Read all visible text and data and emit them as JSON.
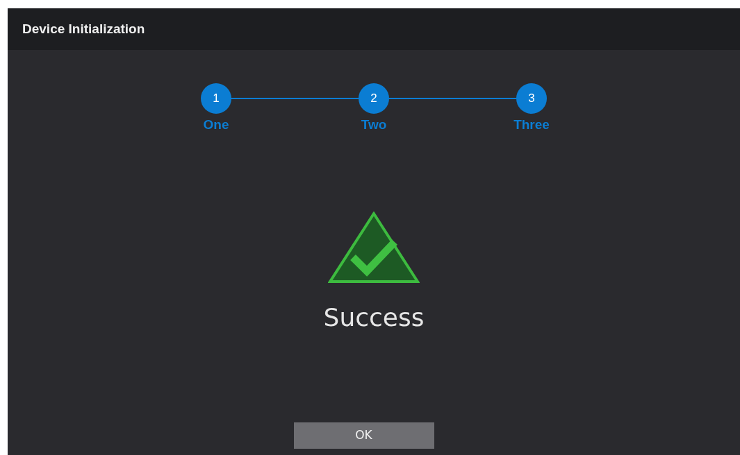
{
  "window": {
    "title": "Device Initialization"
  },
  "steps": [
    {
      "number": "1",
      "label": "One",
      "done": true
    },
    {
      "number": "2",
      "label": "Two",
      "done": true
    },
    {
      "number": "3",
      "label": "Three",
      "done": true
    }
  ],
  "status": {
    "kind": "success",
    "message": "Success"
  },
  "buttons": [
    {
      "label": "OK"
    }
  ]
}
